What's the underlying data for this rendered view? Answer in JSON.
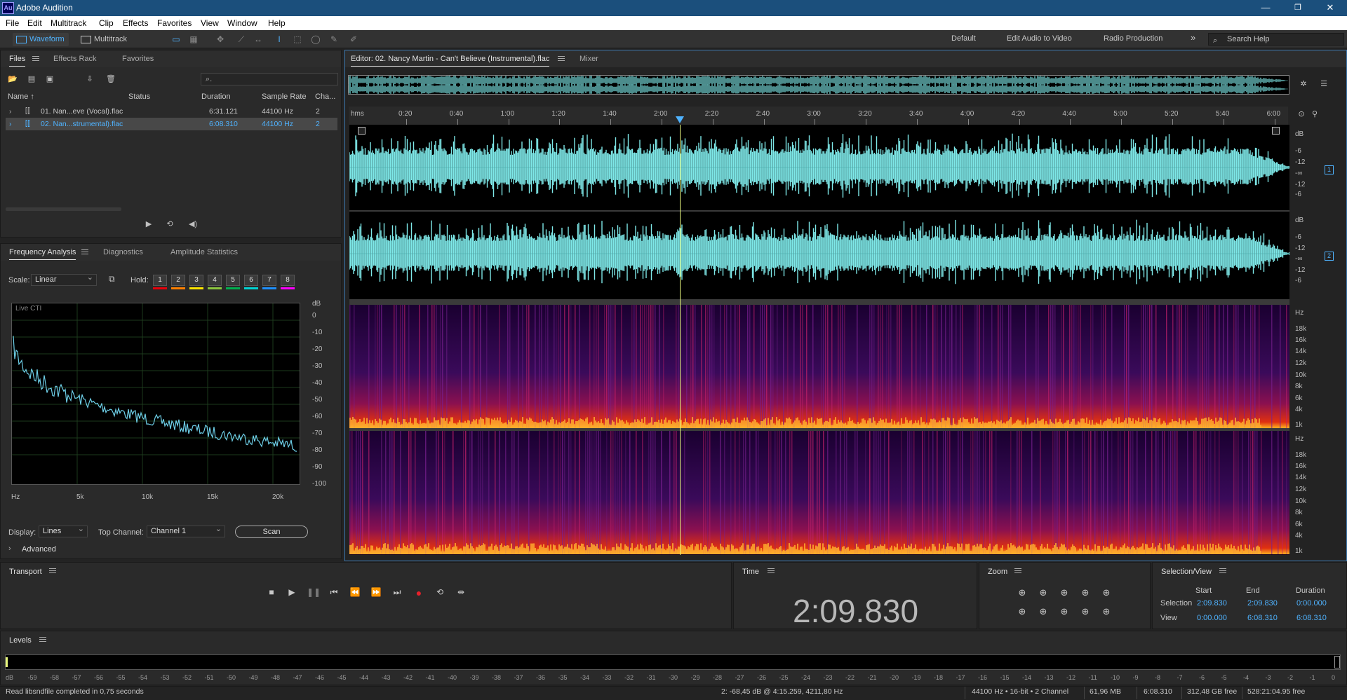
{
  "app": {
    "title": "Adobe Audition",
    "logo_text": "Au"
  },
  "menu": [
    "File",
    "Edit",
    "Multitrack",
    "Clip",
    "Effects",
    "Favorites",
    "View",
    "Window",
    "Help"
  ],
  "toolbar": {
    "waveform_label": "Waveform",
    "multitrack_label": "Multitrack",
    "workspaces": [
      "Default",
      "Edit Audio to Video",
      "Radio Production"
    ],
    "more": "»",
    "search_placeholder": "Search Help"
  },
  "files_panel": {
    "tabs": [
      "Files",
      "Effects Rack",
      "Favorites"
    ],
    "search_glyph": "⌕.",
    "columns": [
      "Name ↑",
      "Status",
      "Duration",
      "Sample Rate",
      "Cha..."
    ],
    "rows": [
      {
        "name": "01. Nan...eve (Vocal).flac",
        "duration": "6:31.121",
        "rate": "44100 Hz",
        "channels": "2",
        "selected": false
      },
      {
        "name": "02. Nan...strumental).flac",
        "duration": "6:08.310",
        "rate": "44100 Hz",
        "channels": "2",
        "selected": true
      }
    ]
  },
  "freq_panel": {
    "tabs": [
      "Frequency Analysis",
      "Diagnostics",
      "Amplitude Statistics"
    ],
    "scale_label": "Scale:",
    "scale_value": "Linear",
    "hold_label": "Hold:",
    "hold": [
      "1",
      "2",
      "3",
      "4",
      "5",
      "6",
      "7",
      "8"
    ],
    "hold_colors": [
      "#e8000b",
      "#ff8000",
      "#ffe500",
      "#8cc63f",
      "#00b050",
      "#00d4d4",
      "#1e90ff",
      "#ff00ff"
    ],
    "graph_label": "Live CTI",
    "db_unit": "dB",
    "db_ticks": [
      "0",
      "-10",
      "-20",
      "-30",
      "-40",
      "-50",
      "-60",
      "-70",
      "-80",
      "-90",
      "-100"
    ],
    "hz_ticks": [
      "Hz",
      "5k",
      "10k",
      "15k",
      "20k"
    ],
    "display_label": "Display:",
    "display_value": "Lines",
    "top_channel_label": "Top Channel:",
    "top_channel_value": "Channel 1",
    "scan_label": "Scan",
    "advanced_label": "Advanced"
  },
  "editor": {
    "tab_label": "Editor: 02. Nancy Martin - Can't Believe (Instrumental).flac",
    "mixer_label": "Mixer",
    "timeline_unit": "hms",
    "timeline": [
      "0:20",
      "0:40",
      "1:00",
      "1:20",
      "1:40",
      "2:00",
      "2:20",
      "2:40",
      "3:00",
      "3:20",
      "3:40",
      "4:00",
      "4:20",
      "4:40",
      "5:00",
      "5:20",
      "5:40",
      "6:00"
    ],
    "db_scale": [
      "dB",
      "-6",
      "-12",
      "-∞",
      "-12",
      "-6"
    ],
    "channel_badges": [
      "1",
      "2"
    ],
    "hz_scale": [
      "Hz",
      "18k",
      "16k",
      "14k",
      "12k",
      "10k",
      "8k",
      "6k",
      "4k",
      "1k"
    ],
    "waveform_color": "#7ee8e8",
    "playhead_color": "#e8f87c"
  },
  "transport": {
    "title": "Transport"
  },
  "time": {
    "title": "Time",
    "value": "2:09.830"
  },
  "zoom": {
    "title": "Zoom"
  },
  "selection_view": {
    "title": "Selection/View",
    "headers": [
      "Start",
      "End",
      "Duration"
    ],
    "rows": [
      {
        "label": "Selection",
        "start": "2:09.830",
        "end": "2:09.830",
        "duration": "0:00.000"
      },
      {
        "label": "View",
        "start": "0:00.000",
        "end": "6:08.310",
        "duration": "6:08.310"
      }
    ]
  },
  "levels": {
    "title": "Levels",
    "ticks": [
      "dB",
      "-59",
      "-58",
      "-57",
      "-56",
      "-55",
      "-54",
      "-53",
      "-52",
      "-51",
      "-50",
      "-49",
      "-48",
      "-47",
      "-46",
      "-45",
      "-44",
      "-43",
      "-42",
      "-41",
      "-40",
      "-39",
      "-38",
      "-37",
      "-36",
      "-35",
      "-34",
      "-33",
      "-32",
      "-31",
      "-30",
      "-29",
      "-28",
      "-27",
      "-26",
      "-25",
      "-24",
      "-23",
      "-22",
      "-21",
      "-20",
      "-19",
      "-18",
      "-17",
      "-16",
      "-15",
      "-14",
      "-13",
      "-12",
      "-11",
      "-10",
      "-9",
      "-8",
      "-7",
      "-6",
      "-5",
      "-4",
      "-3",
      "-2",
      "-1",
      "0"
    ]
  },
  "status": {
    "message": "Read libsndfile completed in 0,75 seconds",
    "cursor": "2: -68,45 dB @ 4:15.259, 4211,80 Hz",
    "format": "44100 Hz • 16-bit • 2 Channel",
    "size": "61,96 MB",
    "duration": "6:08.310",
    "free": "312,48 GB free",
    "free_time": "528:21:04.95 free"
  }
}
